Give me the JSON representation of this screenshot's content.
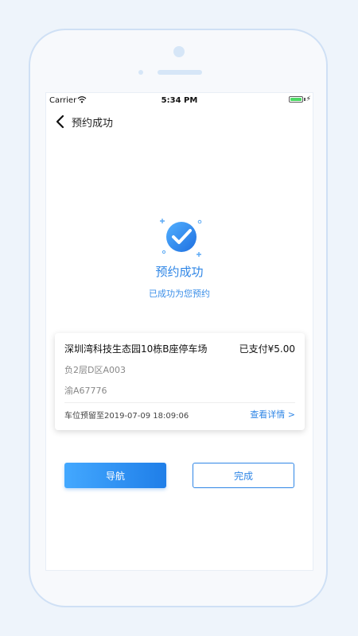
{
  "status_bar": {
    "carrier": "Carrier",
    "time": "5:34 PM",
    "charging": "⚡"
  },
  "nav": {
    "title": "预约成功"
  },
  "result": {
    "title": "预约成功",
    "subtitle": "已成功为您预约"
  },
  "card": {
    "lot_name": "深圳湾科技生态园10栋B座停车场",
    "paid": "已支付¥5.00",
    "spot": "负2层D区A003",
    "plate": "渝A67776",
    "reserve_until": "车位预留至2019-07-09 18:09:06",
    "details_link": "查看详情 >"
  },
  "buttons": {
    "navigate": "导航",
    "done": "完成"
  },
  "colors": {
    "accent": "#2f86e6",
    "button_gradient_start": "#43a8ff",
    "button_gradient_end": "#1f7ee8"
  },
  "icons": {
    "back": "chevron-left-icon",
    "success": "check-circle-icon",
    "wifi": "wifi-icon",
    "battery": "battery-icon"
  }
}
